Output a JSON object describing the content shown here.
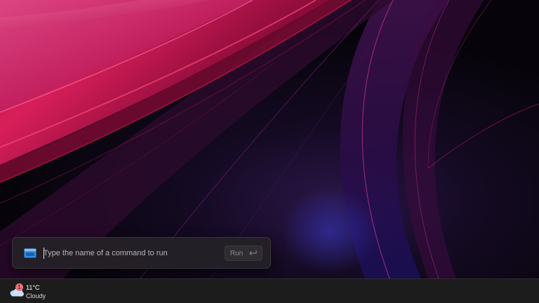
{
  "run_dialog": {
    "placeholder": "Type the name of a command to run",
    "value": "",
    "run_label": "Run",
    "icon": "run-window-icon",
    "accent_color": "#2f8fe8"
  },
  "taskbar": {
    "weather": {
      "temperature": "11°C",
      "condition": "Cloudy",
      "badge": "1",
      "icon": "cloudy-weather-icon"
    }
  },
  "wallpaper": {
    "colors": [
      "#c8144a",
      "#e8327a",
      "#5a1a7a",
      "#1a0a3a",
      "#050308"
    ]
  }
}
